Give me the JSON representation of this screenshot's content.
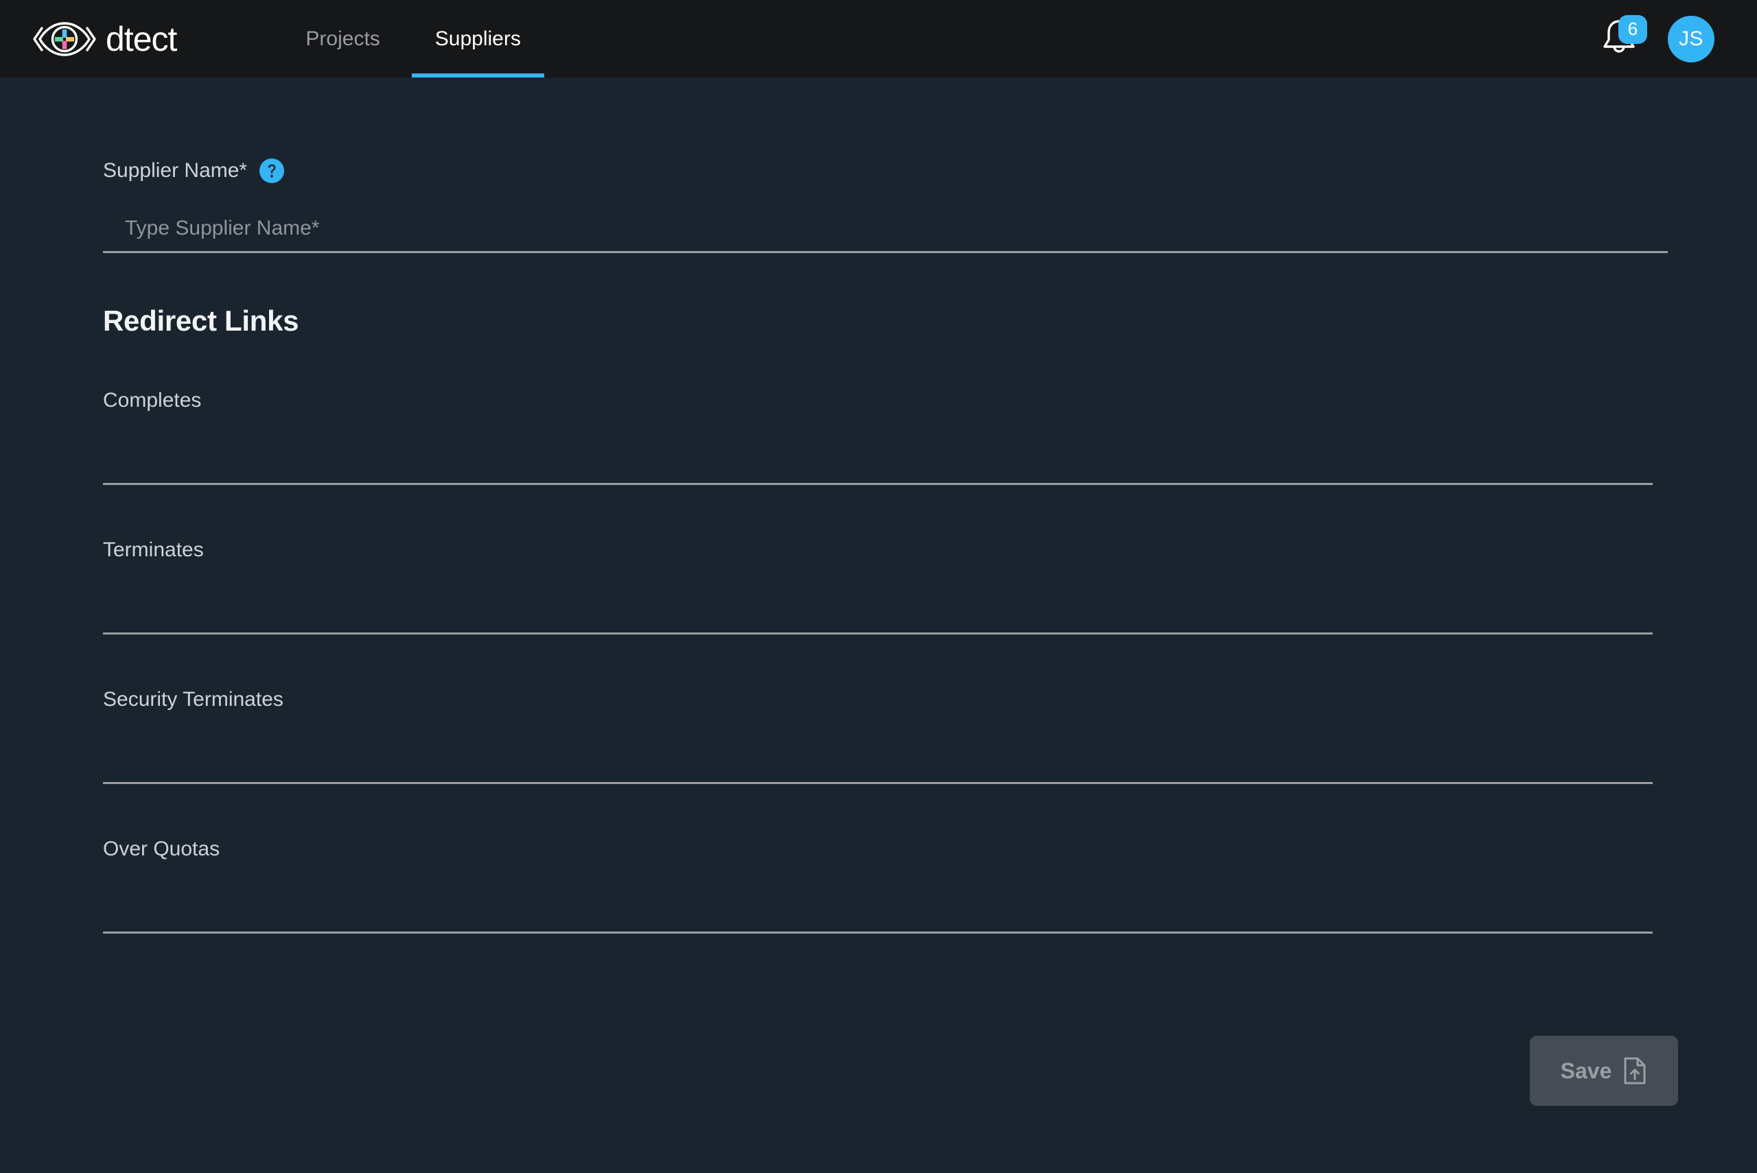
{
  "brand": {
    "word": "dtect",
    "logo_icon": "eye-plus-logo",
    "plus_colors": {
      "left": "#5fd6a0",
      "top": "#4fc3f7",
      "right": "#f5c462",
      "bottom": "#f06fb0"
    }
  },
  "nav": {
    "tabs": [
      {
        "label": "Projects",
        "active": false
      },
      {
        "label": "Suppliers",
        "active": true
      }
    ],
    "active_underline_color": "#35b4f5"
  },
  "header_right": {
    "notifications": {
      "icon": "bell-icon",
      "badge_count": "6",
      "badge_color": "#35b4f5"
    },
    "avatar": {
      "initials": "JS",
      "color": "#35b4f5"
    }
  },
  "form": {
    "supplier_name": {
      "label": "Supplier Name*",
      "help_icon": "help-circle-icon",
      "placeholder": "Type Supplier Name*",
      "value": ""
    },
    "section_title": "Redirect Links",
    "redirect_links": [
      {
        "label": "Completes",
        "placeholder": "",
        "value": ""
      },
      {
        "label": "Terminates",
        "placeholder": "",
        "value": ""
      },
      {
        "label": "Security Terminates",
        "placeholder": "",
        "value": ""
      },
      {
        "label": "Over Quotas",
        "placeholder": "",
        "value": ""
      }
    ]
  },
  "footer": {
    "save_label": "Save",
    "save_icon": "file-upload-icon",
    "save_disabled": true
  },
  "colors": {
    "header_bg": "#161719",
    "page_bg": "#1a242f",
    "accent": "#35b4f5",
    "underline": "#9a9fa4",
    "label_text": "#ced3d8",
    "save_bg": "#454c55"
  }
}
